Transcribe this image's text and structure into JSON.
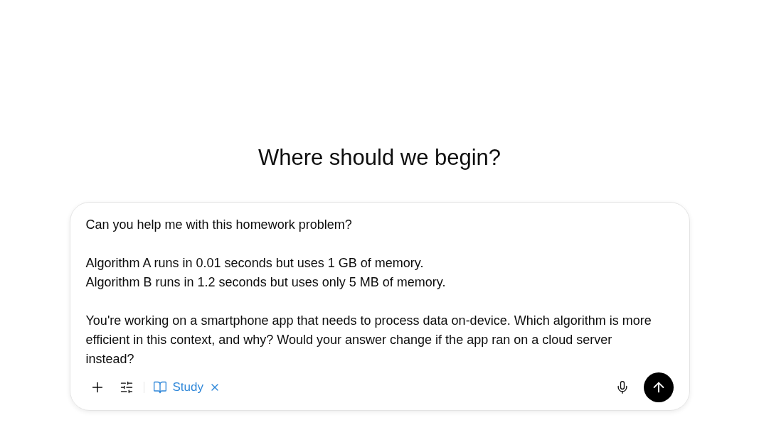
{
  "heading": "Where should we begin?",
  "composer": {
    "paragraphs": [
      [
        "Can you help me with this homework problem?"
      ],
      [
        "Algorithm A runs in 0.01 seconds but uses 1 GB of memory.",
        "Algorithm B runs in 1.2 seconds but uses only 5 MB of memory."
      ],
      [
        "You're working on a smartphone app that needs to process data on-device. Which algorithm is more efficient in this context, and why? Would your answer change if the app ran on a cloud server instead?"
      ]
    ],
    "tool": {
      "label": "Study"
    }
  }
}
